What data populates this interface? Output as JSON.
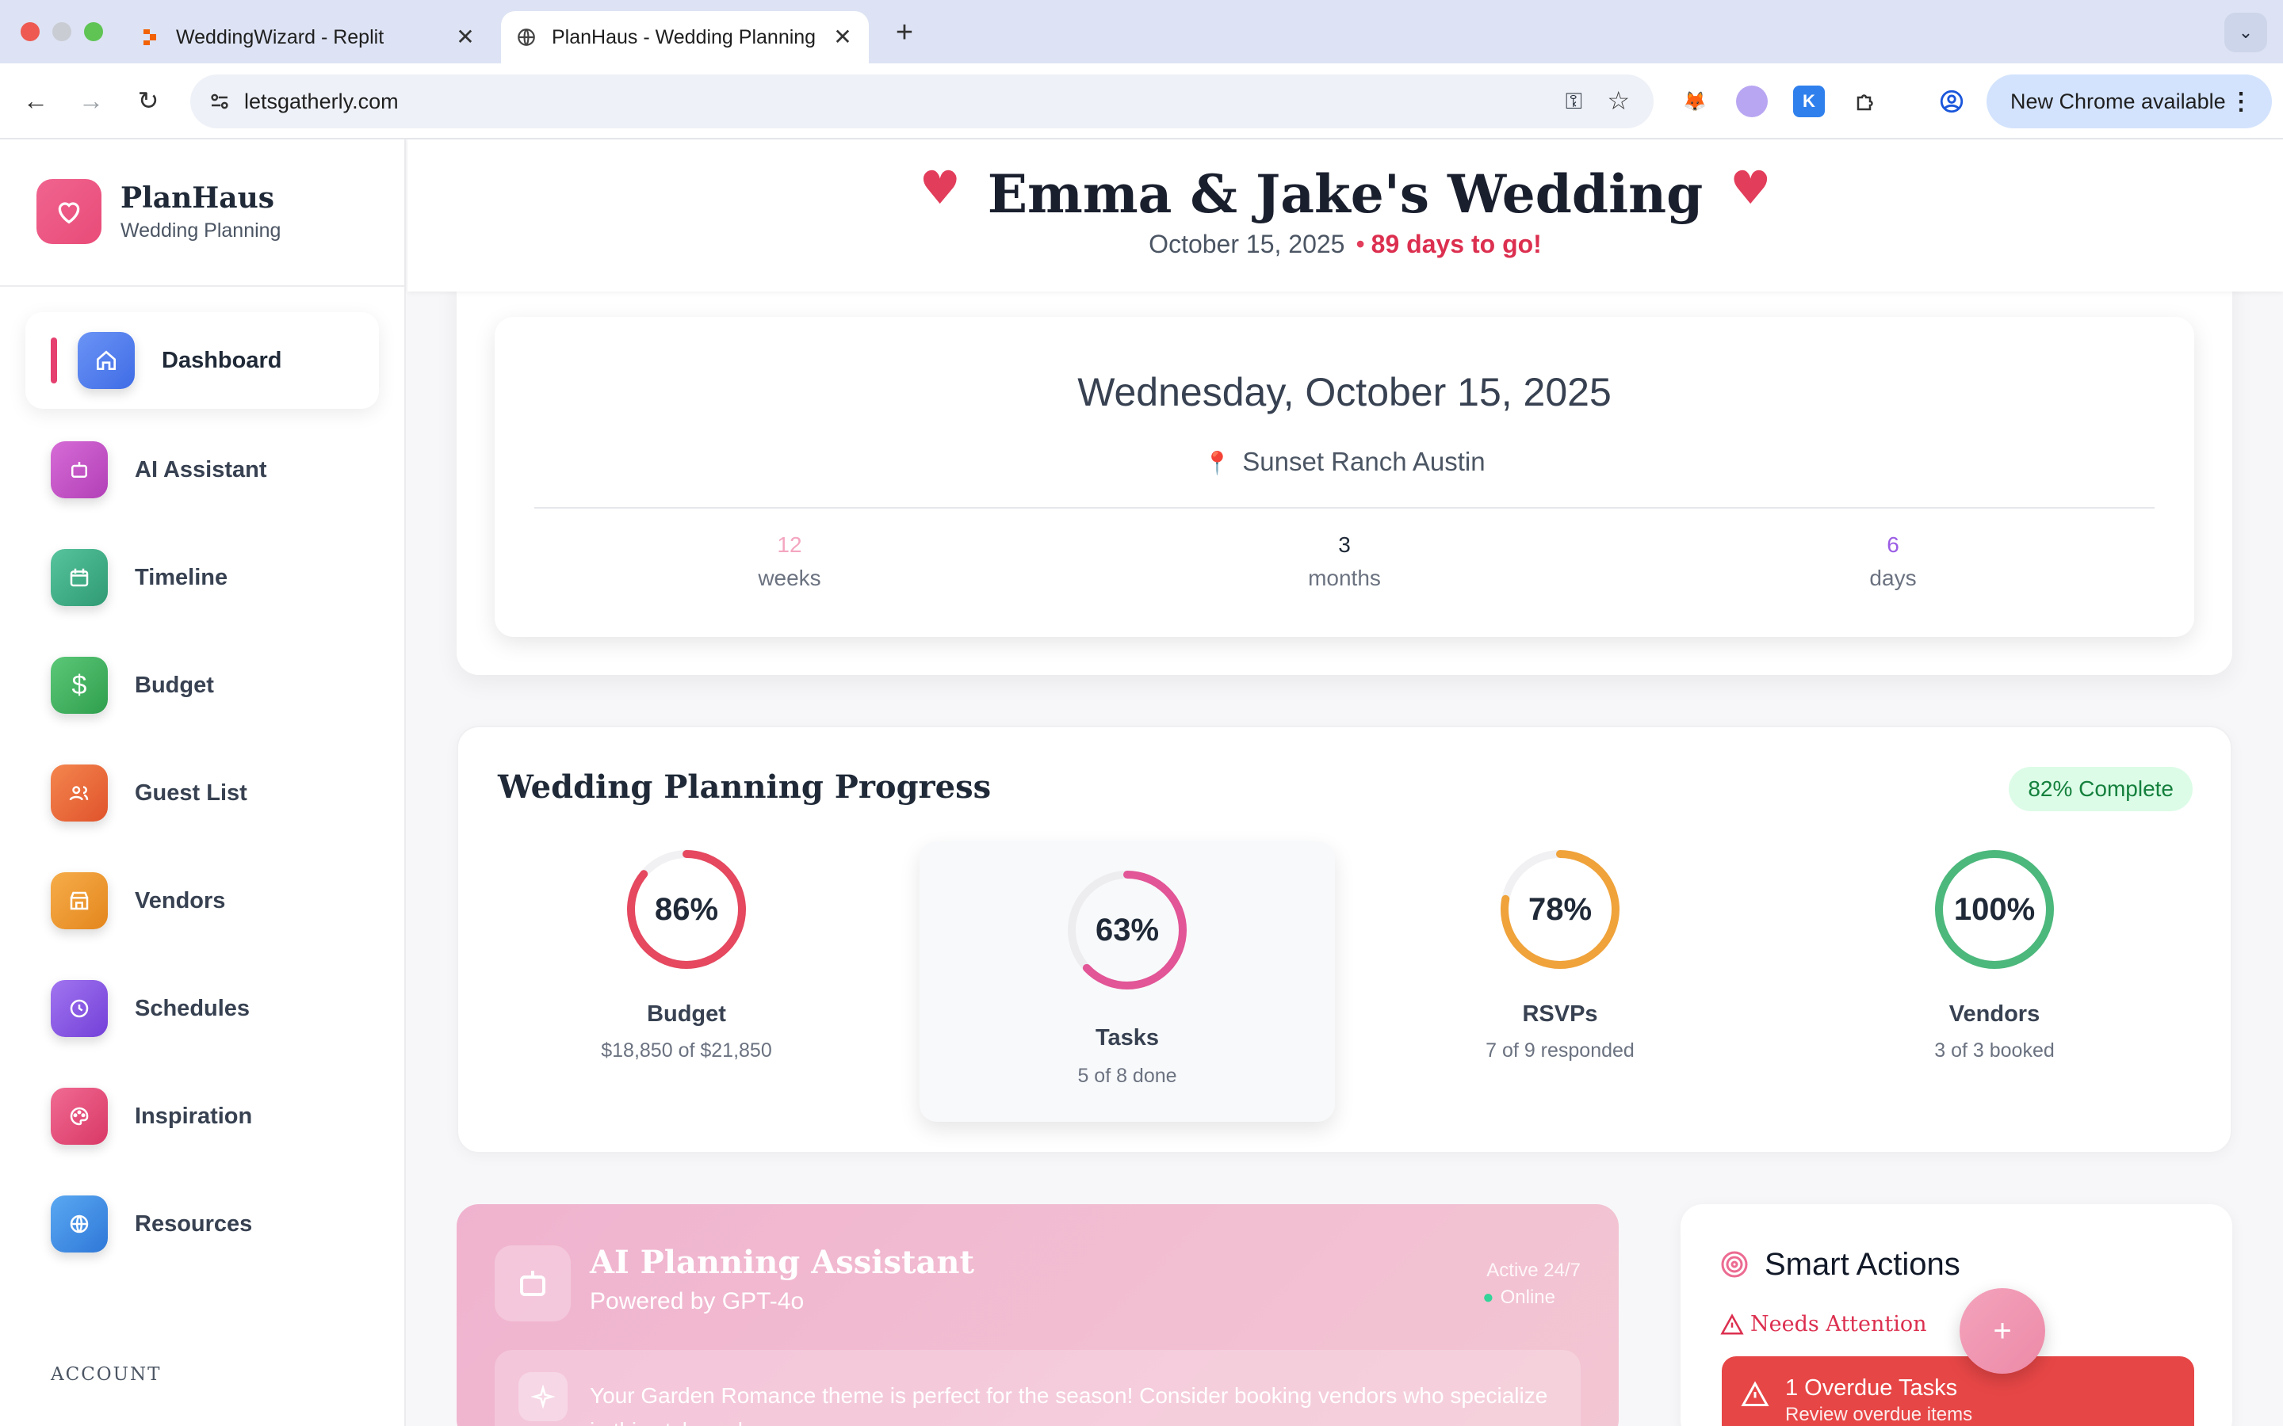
{
  "browser": {
    "tabs": [
      {
        "title": "WeddingWizard - Replit",
        "active": false
      },
      {
        "title": "PlanHaus - Wedding Planning",
        "active": true
      }
    ],
    "url": "letsgatherly.com",
    "update_button": "New Chrome available"
  },
  "sidebar": {
    "brand_title": "PlanHaus",
    "brand_subtitle": "Wedding Planning",
    "items": [
      {
        "label": "Dashboard",
        "icon": "home-icon",
        "color": "#4f7cf0",
        "active": true
      },
      {
        "label": "AI Assistant",
        "icon": "robot-icon",
        "color": "#c04bc8"
      },
      {
        "label": "Timeline",
        "icon": "calendar-icon",
        "color": "#3fae86"
      },
      {
        "label": "Budget",
        "icon": "dollar-icon",
        "color": "#3fb35f"
      },
      {
        "label": "Guest List",
        "icon": "users-icon",
        "color": "#f26a3d"
      },
      {
        "label": "Vendors",
        "icon": "store-icon",
        "color": "#f29a2e"
      },
      {
        "label": "Schedules",
        "icon": "clock-icon",
        "color": "#8b55e6"
      },
      {
        "label": "Inspiration",
        "icon": "palette-icon",
        "color": "#e84c78"
      },
      {
        "label": "Resources",
        "icon": "globe-icon",
        "color": "#3e8ee6"
      }
    ],
    "account_label": "ACCOUNT"
  },
  "header": {
    "title": "Emma & Jake's Wedding",
    "date": "October 15, 2025",
    "countdown": "89 days to go!"
  },
  "event_card": {
    "full_date": "Wednesday, October 15, 2025",
    "venue": "Sunset Ranch Austin",
    "counts": [
      {
        "value": "12",
        "label": "weeks",
        "color": "#f4a6c0"
      },
      {
        "value": "3",
        "label": "months",
        "color": "#1f2937"
      },
      {
        "value": "6",
        "label": "days",
        "color": "#9b5de5"
      }
    ]
  },
  "progress": {
    "title": "Wedding Planning Progress",
    "overall": "82% Complete",
    "metrics": [
      {
        "name": "Budget",
        "percent": 86,
        "label": "86%",
        "detail": "$18,850 of $21,850",
        "color": "#e5485f"
      },
      {
        "name": "Tasks",
        "percent": 63,
        "label": "63%",
        "detail": "5 of 8 done",
        "color": "#e25596",
        "highlight": true
      },
      {
        "name": "RSVPs",
        "percent": 78,
        "label": "78%",
        "detail": "7 of 9 responded",
        "color": "#f0a33a"
      },
      {
        "name": "Vendors",
        "percent": 100,
        "label": "100%",
        "detail": "3 of 3 booked",
        "color": "#4cb87c"
      }
    ]
  },
  "ai_assistant": {
    "title": "AI Planning Assistant",
    "subtitle": "Powered by GPT-4o",
    "status_line": "Active 24/7",
    "online": "Online",
    "message": "Your Garden Romance theme is perfect for the season! Consider booking vendors who specialize in this style early."
  },
  "smart_actions": {
    "title": "Smart Actions",
    "needs_attention": "Needs Attention",
    "overdue_title": "1 Overdue Tasks",
    "overdue_sub": "Review overdue items",
    "fab_label": "+"
  }
}
